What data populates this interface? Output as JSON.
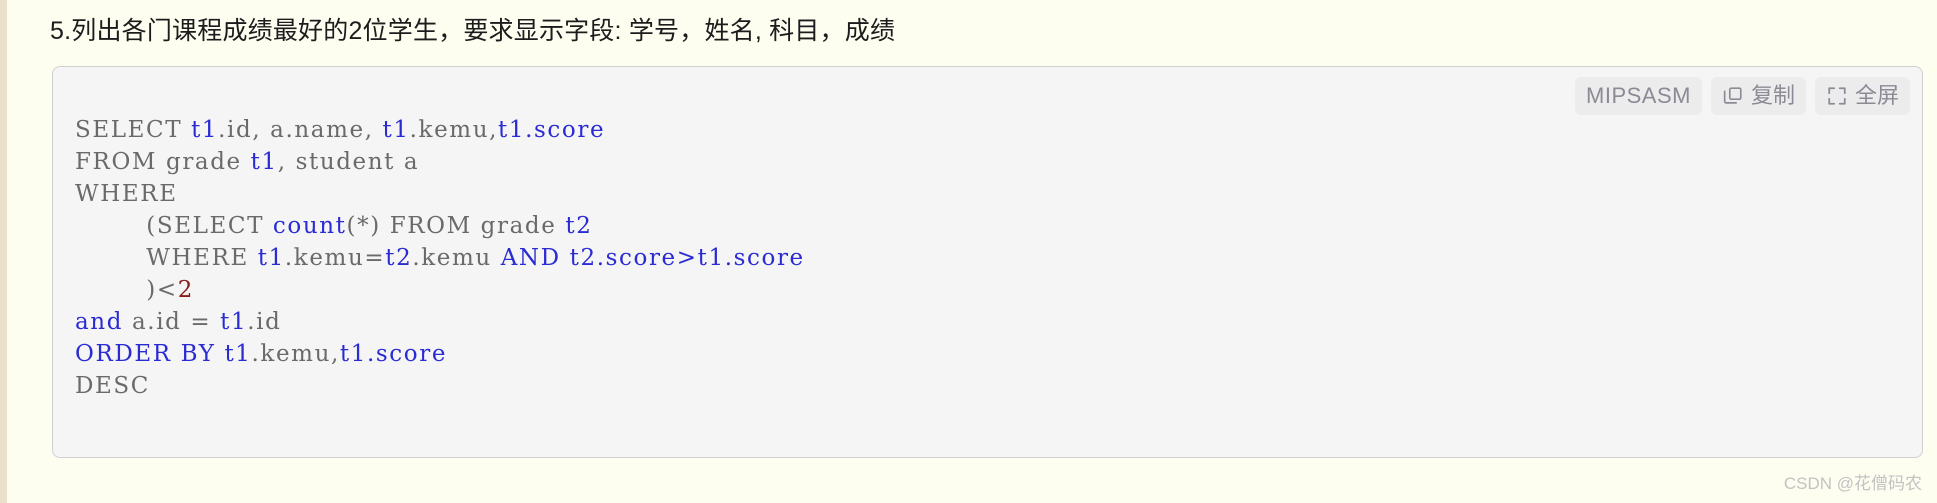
{
  "page": {
    "background_color": "#fdfdf0",
    "edge_strip_color": "#e8e0c8"
  },
  "heading": {
    "text": "5.列出各门课程成绩最好的2位学生，要求显示字段: 学号，姓名, 科目，成绩"
  },
  "code_block": {
    "background_color": "#f5f5f5",
    "border_color": "#d0d0d0",
    "toolbar": {
      "language_label": "MIPSASM",
      "copy_label": "复制",
      "copy_icon": "copy-icon",
      "fullscreen_label": "全屏",
      "fullscreen_icon": "fullscreen-icon"
    },
    "syntax_colors": {
      "plain": "#6a6a6a",
      "keyword": "#2b2bd4",
      "identifier": "#2b2bd4",
      "function": "#2b2bd4",
      "number": "#8b1a1a"
    },
    "lines": [
      [
        {
          "t": "SELECT ",
          "c": "plain"
        },
        {
          "t": "t1",
          "c": "id"
        },
        {
          "t": ".id, a.name, ",
          "c": "plain"
        },
        {
          "t": "t1",
          "c": "id"
        },
        {
          "t": ".kemu,",
          "c": "plain"
        },
        {
          "t": "t1.score",
          "c": "id"
        }
      ],
      [
        {
          "t": "FROM grade ",
          "c": "plain"
        },
        {
          "t": "t1",
          "c": "id"
        },
        {
          "t": ", student a",
          "c": "plain"
        }
      ],
      [
        {
          "t": "WHERE",
          "c": "plain"
        }
      ],
      [
        {
          "t": "        (SELECT ",
          "c": "plain"
        },
        {
          "t": "count",
          "c": "fn"
        },
        {
          "t": "(*) FROM grade ",
          "c": "plain"
        },
        {
          "t": "t2",
          "c": "id"
        }
      ],
      [
        {
          "t": "        WHERE ",
          "c": "plain"
        },
        {
          "t": "t1",
          "c": "id"
        },
        {
          "t": ".kemu=",
          "c": "plain"
        },
        {
          "t": "t2",
          "c": "id"
        },
        {
          "t": ".kemu ",
          "c": "plain"
        },
        {
          "t": "AND",
          "c": "kw"
        },
        {
          "t": " ",
          "c": "plain"
        },
        {
          "t": "t2.score>t1.score",
          "c": "id"
        }
      ],
      [
        {
          "t": "        )<",
          "c": "plain"
        },
        {
          "t": "2",
          "c": "num"
        }
      ],
      [
        {
          "t": "and",
          "c": "kw"
        },
        {
          "t": " a.id = ",
          "c": "plain"
        },
        {
          "t": "t1",
          "c": "id"
        },
        {
          "t": ".id",
          "c": "plain"
        }
      ],
      [
        {
          "t": "ORDER BY",
          "c": "kw"
        },
        {
          "t": " ",
          "c": "plain"
        },
        {
          "t": "t1",
          "c": "id"
        },
        {
          "t": ".kemu,",
          "c": "plain"
        },
        {
          "t": "t1.score",
          "c": "id"
        }
      ],
      [
        {
          "t": "DESC",
          "c": "plain"
        }
      ]
    ]
  },
  "watermark": {
    "text": "CSDN @花僧码农"
  }
}
